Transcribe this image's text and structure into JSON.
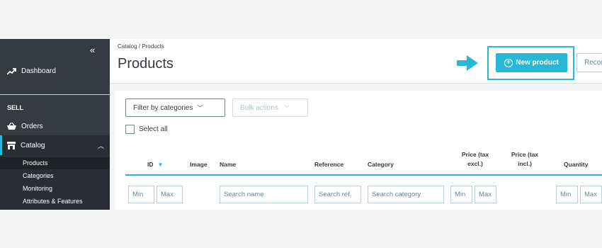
{
  "sidebar": {
    "collapse_glyph": "«",
    "dashboard": "Dashboard",
    "section": "SELL",
    "orders": "Orders",
    "catalog": "Catalog",
    "submenu": [
      "Products",
      "Categories",
      "Monitoring",
      "Attributes & Features"
    ]
  },
  "header": {
    "breadcrumb": "Catalog /  Products",
    "title": "Products",
    "new_product": "New product",
    "recommended": "Recom",
    "accent": "#25b9d7"
  },
  "toolbar": {
    "filter": "Filter by categories",
    "bulk": "Bulk actions",
    "select_all": "Select all"
  },
  "table": {
    "headers": {
      "id": "ID",
      "image": "Image",
      "name": "Name",
      "reference": "Reference",
      "category": "Category",
      "price_tax_excl": "Price (tax excl.)",
      "price_tax_incl": "Price (tax incl.)",
      "quantity": "Quantity"
    },
    "filters": {
      "id_min": "Min",
      "id_max": "Max",
      "name": "Search name",
      "reference": "Search ref.",
      "category": "Search category",
      "price_min": "Min",
      "price_max": "Max",
      "qty_min": "Min",
      "qty_max": "Max"
    }
  }
}
